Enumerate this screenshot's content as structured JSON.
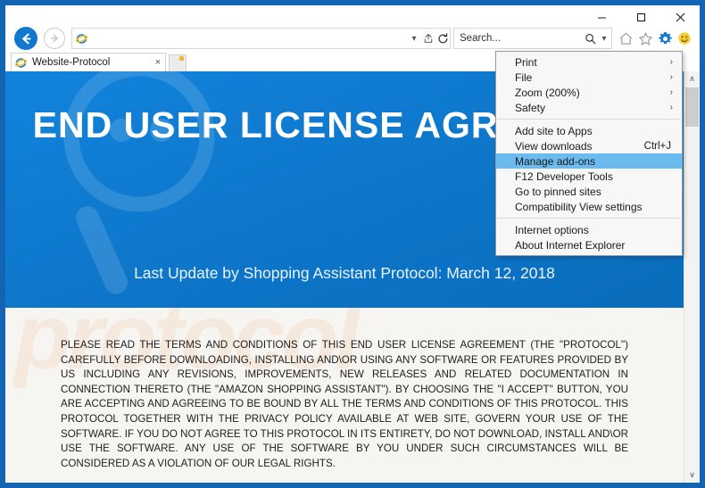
{
  "window": {
    "controls": [
      {
        "name": "minimize",
        "glyph": "–"
      },
      {
        "name": "maximize",
        "glyph": "☐"
      },
      {
        "name": "close",
        "glyph": "✕"
      }
    ]
  },
  "nav": {
    "back_title": "Back",
    "forward_title": "Forward",
    "address_value": "",
    "address_placeholder": "",
    "dropdown_glyph": "▾",
    "compat_glyph": "⎙",
    "refresh_glyph": "↻"
  },
  "search": {
    "value": "Search...",
    "magnifier_glyph": "⌕",
    "dropdown_glyph": "▾"
  },
  "toolbar_icons": [
    {
      "name": "home-icon",
      "glyph": "⌂",
      "color": "#9a9a9a"
    },
    {
      "name": "favorites-star-icon",
      "glyph": "☆",
      "color": "#9a9a9a"
    },
    {
      "name": "tools-gear-icon",
      "glyph": "⚙",
      "color": "#1379d0"
    },
    {
      "name": "smiley-feedback-icon",
      "glyph": "☺",
      "color": "#f5c518"
    }
  ],
  "tabs": {
    "items": [
      {
        "title": "Website-Protocol",
        "close_glyph": "×"
      }
    ],
    "new_tab_title": "New tab"
  },
  "gear_menu": {
    "items": [
      {
        "label": "Print",
        "accel": "",
        "submenu": true,
        "selected": false,
        "separator_after": false
      },
      {
        "label": "File",
        "accel": "",
        "submenu": true,
        "selected": false,
        "separator_after": false
      },
      {
        "label": "Zoom (200%)",
        "accel": "",
        "submenu": true,
        "selected": false,
        "separator_after": false
      },
      {
        "label": "Safety",
        "accel": "",
        "submenu": true,
        "selected": false,
        "separator_after": true
      },
      {
        "label": "Add site to Apps",
        "accel": "",
        "submenu": false,
        "selected": false,
        "separator_after": false
      },
      {
        "label": "View downloads",
        "accel": "Ctrl+J",
        "submenu": false,
        "selected": false,
        "separator_after": false
      },
      {
        "label": "Manage add-ons",
        "accel": "",
        "submenu": false,
        "selected": true,
        "separator_after": false
      },
      {
        "label": "F12 Developer Tools",
        "accel": "",
        "submenu": false,
        "selected": false,
        "separator_after": false
      },
      {
        "label": "Go to pinned sites",
        "accel": "",
        "submenu": false,
        "selected": false,
        "separator_after": false
      },
      {
        "label": "Compatibility View settings",
        "accel": "",
        "submenu": false,
        "selected": false,
        "separator_after": true
      },
      {
        "label": "Internet options",
        "accel": "",
        "submenu": false,
        "selected": false,
        "separator_after": false
      },
      {
        "label": "About Internet Explorer",
        "accel": "",
        "submenu": false,
        "selected": false,
        "separator_after": false
      }
    ],
    "submenu_glyph": "›",
    "highlight_color": "#6cbbef"
  },
  "page": {
    "hero_title": "END USER LICENSE AGREEMENT",
    "hero_subtitle": "Last Update by Shopping Assistant Protocol: March 12, 2018",
    "hero_bg_color": "#0f7cd4",
    "watermark_text": "protocol",
    "eula_text": "PLEASE READ THE TERMS AND CONDITIONS OF THIS END USER LICENSE AGREEMENT (THE \"PROTOCOL\") CAREFULLY BEFORE DOWNLOADING, INSTALLING AND\\OR USING ANY SOFTWARE OR FEATURES PROVIDED BY US INCLUDING ANY REVISIONS, IMPROVEMENTS, NEW RELEASES AND RELATED DOCUMENTATION IN CONNECTION THERETO (THE \"AMAZON SHOPPING ASSISTANT\"). BY CHOOSING THE \"I ACCEPT\" BUTTON, YOU ARE ACCEPTING AND AGREEING TO BE BOUND BY ALL THE TERMS AND CONDITIONS OF THIS PROTOCOL. THIS PROTOCOL TOGETHER WITH THE PRIVACY POLICY AVAILABLE AT WEB SITE, GOVERN YOUR USE OF THE SOFTWARE. IF YOU DO NOT AGREE TO THIS PROTOCOL IN ITS ENTIRETY, DO NOT DOWNLOAD, INSTALL AND\\OR USE THE SOFTWARE. ANY USE OF THE SOFTWARE BY YOU UNDER SUCH CIRCUMSTANCES WILL BE CONSIDERED AS A VIOLATION OF OUR LEGAL RIGHTS."
  },
  "scrollbar": {
    "up_glyph": "∧",
    "down_glyph": "∨"
  }
}
